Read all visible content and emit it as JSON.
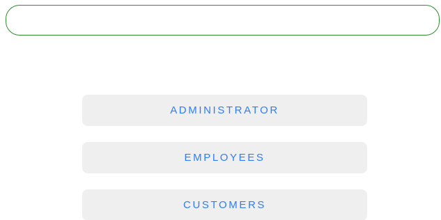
{
  "search": {
    "value": "",
    "placeholder": ""
  },
  "roles": {
    "administrator_label": "ADMINISTRATOR",
    "employees_label": "EMPLOYEES",
    "customers_label": "CUSTOMERS"
  },
  "colors": {
    "input_border": "#2e8b2e",
    "button_background": "#efefef",
    "button_text": "#2f7df4"
  }
}
